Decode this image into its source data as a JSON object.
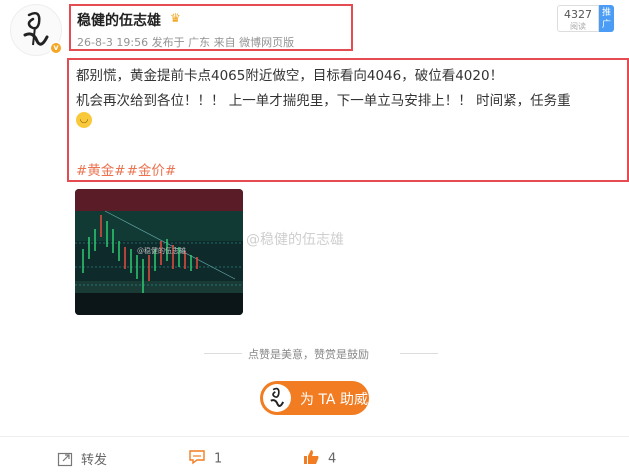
{
  "post": {
    "author": "稳健的伍志雄",
    "meta": "26-8-3 19:56 发布于 广东 来自 微博网页版",
    "views_count": "4327",
    "views_label": "阅读",
    "promote_label": "推广",
    "content_line1": "都别慌，黄金提前卡点4065附近做空，目标看向4046，破位看4020！",
    "content_line2": "机会再次给到各位！！！ 上一单才揣兜里，下一单立马安排上！！ 时间紧，任务重",
    "tags": [
      "#黄金#",
      "#金价#"
    ],
    "image_watermark": "@稳健的伍志雄"
  },
  "support": {
    "encourage_text": "点赞是美意，赞赏是鼓励",
    "help_button_label": "为 TA 助威"
  },
  "actions": {
    "repost_label": "转发",
    "comment_count": "1",
    "like_count": "4"
  },
  "colors": {
    "accent_orange": "#f27c22",
    "tag_orange": "#eb7350",
    "highlight_red": "#e44c52",
    "promote_blue": "#4a9cf5"
  },
  "icons": {
    "crown": "crown-icon",
    "repost": "repost-icon",
    "comment": "comment-icon",
    "like": "like-icon"
  }
}
